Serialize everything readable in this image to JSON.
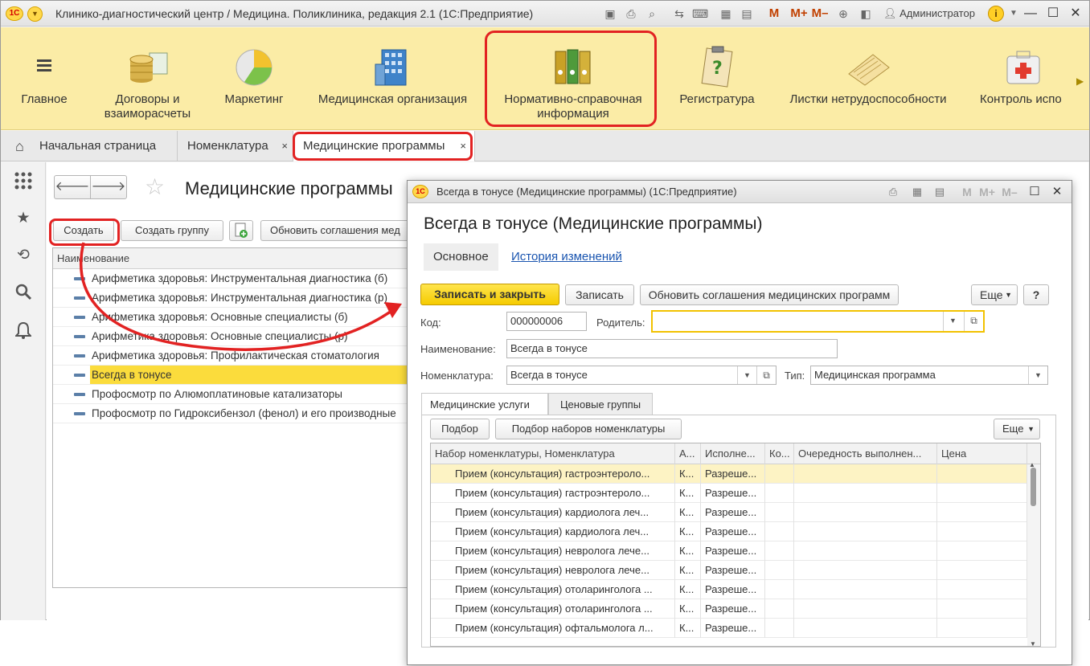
{
  "app": {
    "title": "Клинико-диагностический центр / Медицина. Поликлиника, редакция 2.1  (1С:Предприятие)",
    "user": "Администратор",
    "toolbar": [
      "M",
      "M+",
      "M–"
    ]
  },
  "sections": [
    {
      "label": "Главное",
      "icon": "menu-icon"
    },
    {
      "label": "Договоры и взаиморасчеты",
      "icon": "coins-icon"
    },
    {
      "label": "Маркетинг",
      "icon": "pie-chart-icon"
    },
    {
      "label": "Медицинская организация",
      "icon": "building-icon"
    },
    {
      "label": "Нормативно-справочная информация",
      "icon": "binders-icon",
      "highlighted": true
    },
    {
      "label": "Регистратура",
      "icon": "clipboard-icon"
    },
    {
      "label": "Листки нетрудоспособности",
      "icon": "notebook-icon"
    },
    {
      "label": "Контроль испо",
      "icon": "first-aid-icon"
    }
  ],
  "tabs": [
    {
      "label": "Начальная страница",
      "icon": "home-icon"
    },
    {
      "label": "Номенклатура",
      "close": "×"
    },
    {
      "label": "Медицинские программы",
      "close": "×",
      "active": true
    }
  ],
  "list": {
    "title": "Медицинские программы",
    "buttons": {
      "create": "Создать",
      "create_group": "Создать группу",
      "refresh": "Обновить соглашения мед"
    },
    "column_header": "Наименование",
    "rows": [
      "Арифметика здоровья: Инструментальная диагностика (б)",
      "Арифметика здоровья: Инструментальная диагностика (р)",
      "Арифметика здоровья: Основные специалисты (б)",
      "Арифметика здоровья: Основные специалисты (р)",
      "Арифметика здоровья: Профилактическая стоматология",
      "Всегда в тонусе",
      "Профосмотр по Алюмоплатиновые катализаторы",
      "Профосмотр по Гидроксибензол (фенол) и его производные"
    ],
    "selected_row": "Всегда в тонусе"
  },
  "modal": {
    "title": "Всегда в тонусе (Медицинские программы)  (1С:Предприятие)",
    "heading": "Всегда в тонусе (Медицинские программы)",
    "tabs": {
      "main": "Основное",
      "history": "История изменений"
    },
    "buttons": {
      "save_close": "Записать и закрыть",
      "save": "Записать",
      "refresh": "Обновить соглашения медицинских программ",
      "more": "Еще",
      "help": "?"
    },
    "fields": {
      "code_label": "Код:",
      "code_value": "000000006",
      "parent_label": "Родитель:",
      "parent_value": "",
      "name_label": "Наименование:",
      "name_value": "Всегда в тонусе",
      "nomen_label": "Номенклатура:",
      "nomen_value": "Всегда в тонусе",
      "type_label": "Тип:",
      "type_value": "Медицинская программа"
    },
    "subtabs": {
      "services": "Медицинские услуги",
      "price_groups": "Ценовые группы"
    },
    "sub_buttons": {
      "pick": "Подбор",
      "pick_sets": "Подбор наборов номенклатуры",
      "more": "Еще"
    },
    "grid": {
      "columns": [
        "Набор номенклатуры, Номенклатура",
        "А...",
        "Исполне...",
        "Ко...",
        "Очередность выполнен...",
        "Цена"
      ],
      "rows": [
        [
          "Прием (консультация) гастроэнтероло...",
          "К...",
          "Разреше..."
        ],
        [
          "Прием (консультация) гастроэнтероло...",
          "К...",
          "Разреше..."
        ],
        [
          "Прием (консультация) кардиолога леч...",
          "К...",
          "Разреше..."
        ],
        [
          "Прием (консультация) кардиолога леч...",
          "К...",
          "Разреше..."
        ],
        [
          "Прием (консультация) невролога лече...",
          "К...",
          "Разреше..."
        ],
        [
          "Прием (консультация) невролога лече...",
          "К...",
          "Разреше..."
        ],
        [
          "Прием (консультация) отоларинголога ...",
          "К...",
          "Разреше..."
        ],
        [
          "Прием (консультация) отоларинголога ...",
          "К...",
          "Разреше..."
        ],
        [
          "Прием (консультация) офтальмолога л...",
          "К...",
          "Разреше..."
        ]
      ]
    }
  },
  "colors": {
    "sections_bg": "#fbeca6",
    "highlight_red": "#e22222",
    "selection_yellow": "#fbdc3c",
    "primary_button": "#f5cb00",
    "link_blue": "#1a55b0"
  }
}
